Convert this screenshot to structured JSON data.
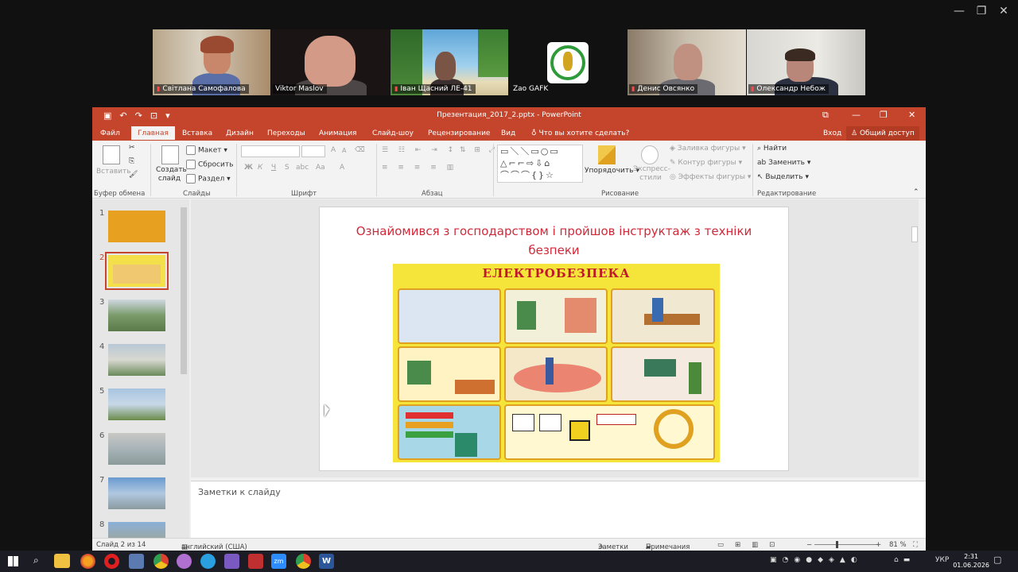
{
  "zoom": {
    "window_controls": {
      "minimize": "—",
      "restore": "❐",
      "close": "✕"
    },
    "participants": [
      {
        "name": "Світлана Самофалова",
        "muted": true
      },
      {
        "name": "Viktor Maslov",
        "muted": false,
        "active": true
      },
      {
        "name": "Іван Щасний ЛЕ-41",
        "muted": true
      },
      {
        "name": "Zao GAFK",
        "muted": false
      },
      {
        "name": "Денис Овсянко",
        "muted": true
      },
      {
        "name": "Олександр Небож",
        "muted": true
      }
    ]
  },
  "powerpoint": {
    "window_title": "Презентация_2017_2.pptx - PowerPoint",
    "tabs": [
      "Файл",
      "Главная",
      "Вставка",
      "Дизайн",
      "Переходы",
      "Анимация",
      "Слайд-шоу",
      "Рецензирование",
      "Вид"
    ],
    "active_tab": "Главная",
    "tell_me": "Что вы хотите сделать?",
    "sign_in": "Вход",
    "share": "Общий доступ",
    "ribbon": {
      "clipboard": {
        "paste": "Вставить",
        "label": "Буфер обмена"
      },
      "slides": {
        "new_slide": "Создать слайд",
        "layout": "Макет",
        "reset": "Сбросить",
        "section": "Раздел",
        "label": "Слайды"
      },
      "font": {
        "grow": "A",
        "shrink": "A",
        "bold": "Ж",
        "italic": "К",
        "underline": "Ч",
        "strike": "S",
        "spacing": "abc",
        "case": "Aa",
        "color": "A",
        "label": "Шрифт"
      },
      "paragraph": {
        "label": "Абзац"
      },
      "drawing": {
        "arrange": "Упорядочить",
        "quick_styles": "Экспресс-стили",
        "shape_fill": "Заливка фигуры",
        "shape_outline": "Контур фигуры",
        "shape_effects": "Эффекты фигуры",
        "label": "Рисование"
      },
      "editing": {
        "find": "Найти",
        "replace": "Заменить",
        "select": "Выделить",
        "label": "Редактирование"
      }
    },
    "thumbnails": [
      {
        "number": "1"
      },
      {
        "number": "2",
        "selected": true
      },
      {
        "number": "3"
      },
      {
        "number": "4"
      },
      {
        "number": "5"
      },
      {
        "number": "6"
      },
      {
        "number": "7"
      },
      {
        "number": "8"
      }
    ],
    "slide": {
      "title": "Ознайомився з господарством і пройшов інструктаж з техніки безпеки",
      "poster_title": "ЕЛЕКТРОБЕЗПЕКА"
    },
    "notes_placeholder": "Заметки к слайду",
    "status": {
      "slide_of": "Слайд 2 из 14",
      "language": "английский (США)",
      "notes": "Заметки",
      "comments": "Примечания",
      "zoom": "81 %"
    }
  },
  "taskbar": {
    "language": "УКР",
    "time": "2:31",
    "date": "01.06.2026"
  },
  "colors": {
    "ppt_accent": "#c4452c",
    "slide_title": "#d02a3a",
    "poster_bg": "#f5e43a",
    "active_speaker": "#2ed06e"
  }
}
